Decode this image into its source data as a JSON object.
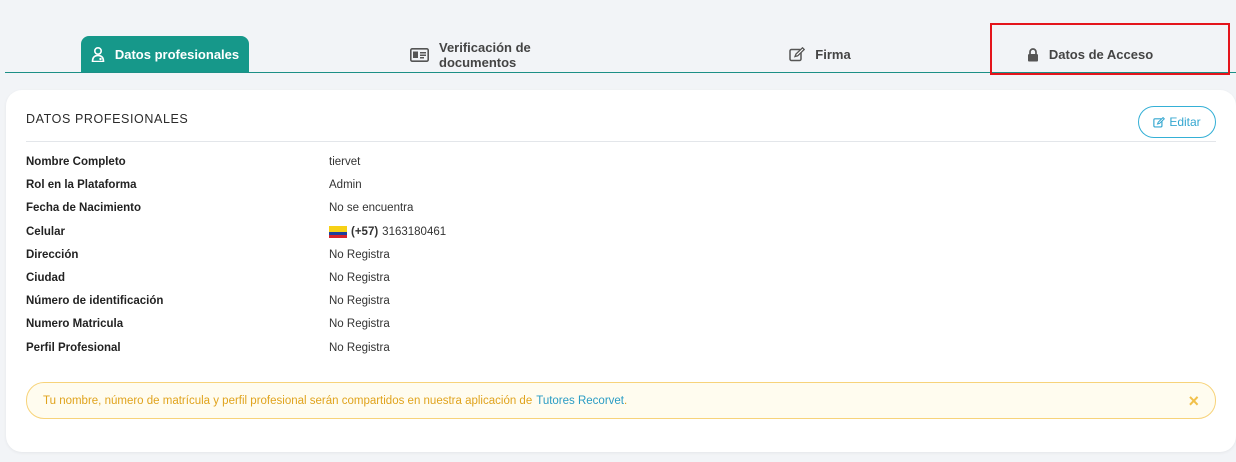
{
  "tabs": [
    {
      "label": "Datos profesionales",
      "icon": "user-doctor-icon",
      "active": true
    },
    {
      "label": "Verificación de documentos",
      "icon": "id-card-icon",
      "active": false
    },
    {
      "label": "Firma",
      "icon": "edit-icon",
      "active": false
    },
    {
      "label": "Datos de Acceso",
      "icon": "lock-icon",
      "active": false
    }
  ],
  "card": {
    "title": "DATOS PROFESIONALES",
    "edit_label": "Editar",
    "fields": [
      {
        "label": "Nombre Completo",
        "value": "tiervet"
      },
      {
        "label": "Rol en la Plataforma",
        "value": "Admin"
      },
      {
        "label": "Fecha de Nacimiento",
        "value": "No se encuentra"
      },
      {
        "label": "Celular",
        "dial_code": "(+57)",
        "value": "3163180461",
        "flag": "colombia-flag-icon"
      },
      {
        "label": "Dirección",
        "value": "No Registra"
      },
      {
        "label": "Ciudad",
        "value": "No Registra"
      },
      {
        "label": "Número de identificación",
        "value": "No Registra"
      },
      {
        "label": "Numero Matricula",
        "value": "No Registra"
      },
      {
        "label": "Perfil Profesional",
        "value": "No Registra"
      }
    ]
  },
  "alert": {
    "text": "Tu nombre, número de matrícula y perfil profesional serán compartidos en nuestra aplicación de",
    "link": "Tutores Recorvet",
    "suffix": ".",
    "close": "×"
  },
  "colors": {
    "accent": "#16988a",
    "link": "#2a9cc4",
    "warning_text": "#e0a31d",
    "highlight": "#e4141b"
  }
}
